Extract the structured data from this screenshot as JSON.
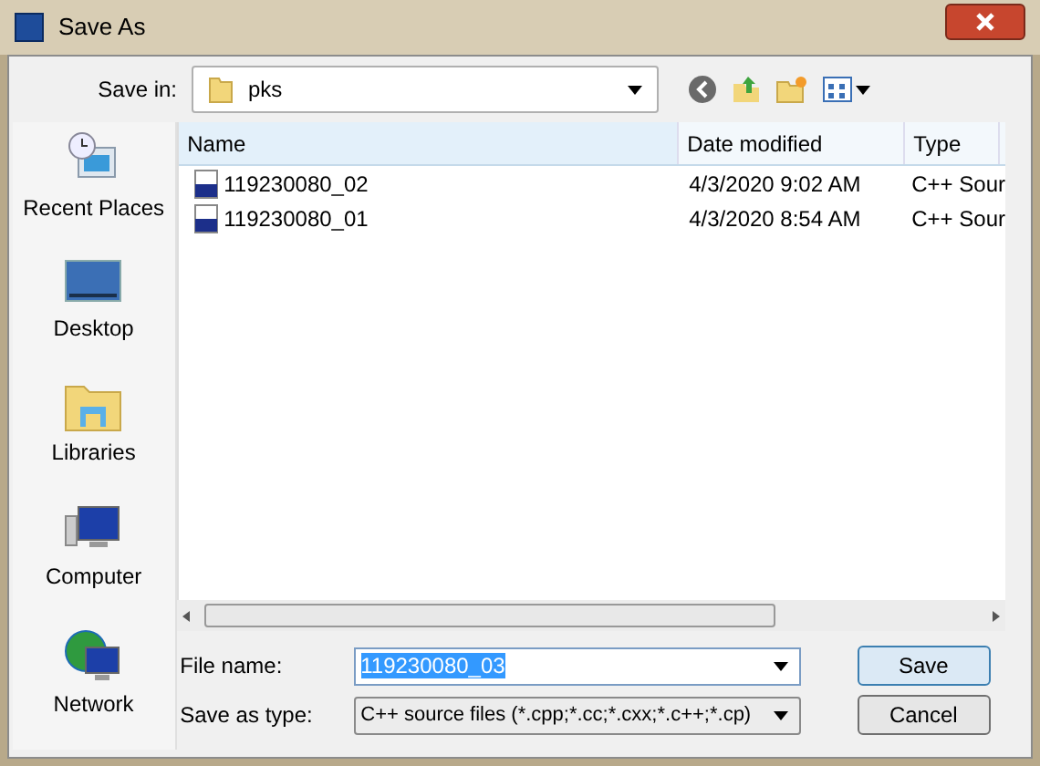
{
  "window": {
    "title": "Save As"
  },
  "save_in": {
    "label": "Save in:",
    "value": "pks"
  },
  "sidebar": {
    "items": [
      {
        "label": "Recent Places",
        "kind": "recent"
      },
      {
        "label": "Desktop",
        "kind": "desktop"
      },
      {
        "label": "Libraries",
        "kind": "libraries"
      },
      {
        "label": "Computer",
        "kind": "computer"
      },
      {
        "label": "Network",
        "kind": "network"
      }
    ]
  },
  "table": {
    "columns": [
      "Name",
      "Date modified",
      "Type"
    ],
    "rows": [
      {
        "name": "119230080_02",
        "date": "4/3/2020 9:02 AM",
        "type": "C++ Sour"
      },
      {
        "name": "119230080_01",
        "date": "4/3/2020 8:54 AM",
        "type": "C++ Sour"
      }
    ]
  },
  "file_name": {
    "label": "File name:",
    "value": "119230080_03"
  },
  "save_as_type": {
    "label": "Save as type:",
    "value": "C++ source files (*.cpp;*.cc;*.cxx;*.c++;*.cp)"
  },
  "buttons": [
    "Save",
    "Cancel"
  ]
}
